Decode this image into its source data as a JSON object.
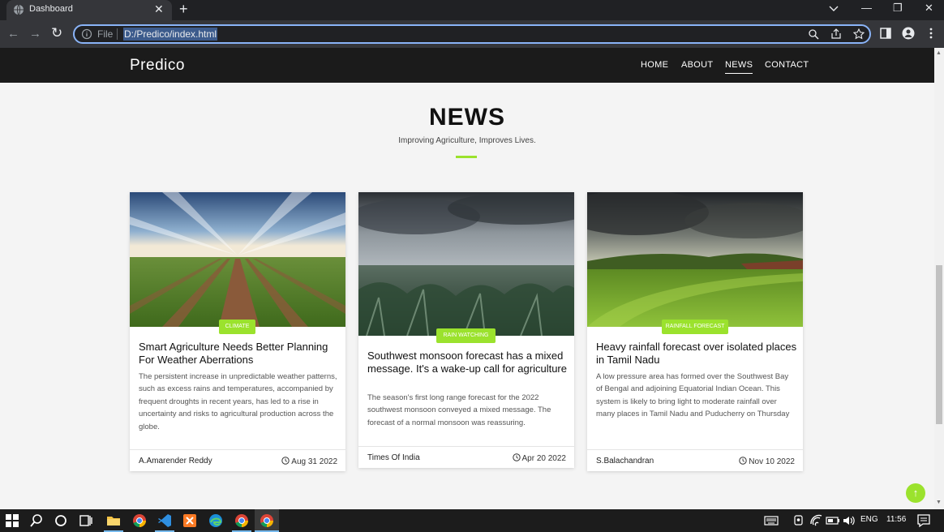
{
  "browser": {
    "tab_title": "Dashboard",
    "tab_close": "✕",
    "new_tab": "+",
    "url_scheme": "File",
    "url": "D:/Predico/index.html",
    "window_controls": {
      "minimize": "—",
      "restore": "❐",
      "close": "✕"
    },
    "nav": {
      "back": "←",
      "forward": "→",
      "reload": "↻"
    }
  },
  "site": {
    "logo": "Predico",
    "menu": [
      "HOME",
      "ABOUT",
      "NEWS",
      "CONTACT"
    ],
    "active_menu": "NEWS",
    "section_title": "NEWS",
    "section_subtitle": "Improving Agriculture, Improves Lives.",
    "accent_color": "#9be22d",
    "back_to_top": "↑"
  },
  "cards": [
    {
      "category": "CLIMATE",
      "title": "Smart Agriculture Needs Better Planning For Weather Aberrations",
      "description": "The persistent increase in unpredictable weather patterns, such as excess rains and temperatures, accompanied by frequent droughts in recent years, has led to a rise in uncertainty and risks to agricultural production across the globe.",
      "author": "A.Amarender Reddy",
      "date": "Aug 31 2022"
    },
    {
      "category": "RAIN WATCHING",
      "title": "Southwest monsoon forecast has a mixed message. It's a wake-up call for agriculture",
      "description": "The season's first long range forecast for the 2022 southwest monsoon conveyed a mixed message. The forecast of a normal monsoon was reassuring.",
      "author": "Times Of India",
      "date": "Apr 20 2022"
    },
    {
      "category": "RAINFALL FORECAST",
      "title": "Heavy rainfall forecast over isolated places in Tamil Nadu",
      "description": "A low pressure area has formed over the Southwest Bay of Bengal and adjoining Equatorial Indian Ocean. This system is likely to bring light to moderate rainfall over many places in Tamil Nadu and Puducherry on Thursday",
      "author": "S.Balachandran",
      "date": "Nov 10 2022"
    }
  ],
  "taskbar": {
    "language": "ENG",
    "time": "11:56"
  }
}
